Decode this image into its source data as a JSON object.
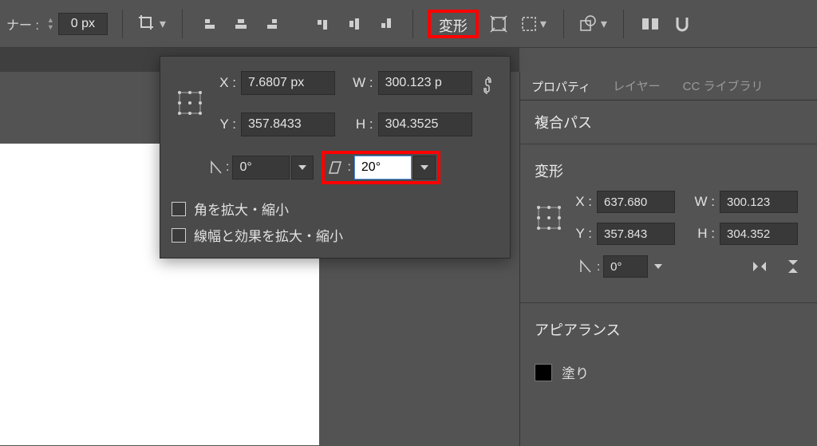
{
  "toolbar": {
    "corner_label": "ナー :",
    "corner_value": "0 px",
    "transform_btn": "変形"
  },
  "transform_popup": {
    "x_label": "X :",
    "x_value": "7.6807 px",
    "y_label": "Y :",
    "y_value": "357.8433",
    "w_label": "W :",
    "w_value": "300.123 p",
    "h_label": "H :",
    "h_value": "304.3525",
    "rotate_value": "0°",
    "shear_value": "20°",
    "chk_scale_corners": "角を拡大・縮小",
    "chk_scale_strokes": "線幅と効果を拡大・縮小"
  },
  "right": {
    "tabs": {
      "properties": "プロパティ",
      "layers": "レイヤー",
      "cc_libraries": "CC ライブラリ"
    },
    "object_type": "複合パス",
    "transform_label": "変形",
    "x_label": "X :",
    "x_value": "637.680",
    "y_label": "Y :",
    "y_value": "357.843",
    "w_label": "W :",
    "w_value": "300.123",
    "h_label": "H :",
    "h_value": "304.352",
    "rotate_value": "0°",
    "appearance_label": "アピアランス",
    "fill_label": "塗り"
  }
}
